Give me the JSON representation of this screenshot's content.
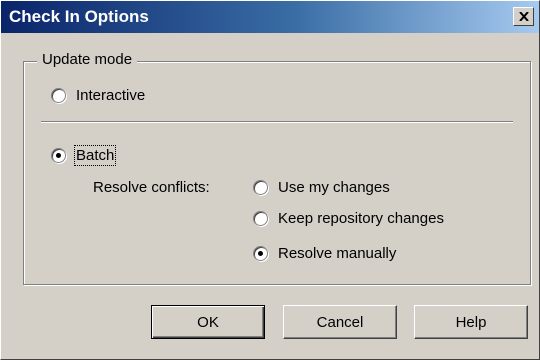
{
  "dialog": {
    "title": "Check In Options"
  },
  "update_mode": {
    "legend": "Update mode",
    "interactive_label": "Interactive",
    "batch_label": "Batch",
    "selected": "Batch"
  },
  "resolve_conflicts": {
    "label": "Resolve conflicts:",
    "options": [
      "Use my changes",
      "Keep repository changes",
      "Resolve manually"
    ],
    "selected": "Resolve manually"
  },
  "buttons": {
    "ok": "OK",
    "cancel": "Cancel",
    "help": "Help"
  },
  "icons": {
    "close": "close-icon"
  },
  "colors": {
    "title_bar_start": "#0a246a",
    "title_bar_end": "#a6caf0",
    "dialog_face": "#d4d0c8"
  }
}
